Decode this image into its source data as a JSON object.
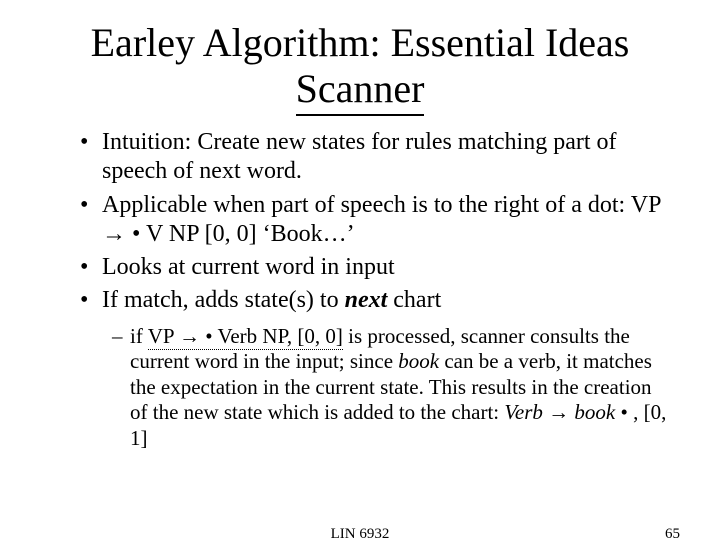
{
  "title_line1": "Earley Algorithm: Essential Ideas",
  "title_line2": "Scanner",
  "bullets": {
    "b1": "Intuition: Create new states for rules matching part of speech of next word.",
    "b2_pre": "Applicable when part of speech is to the right of a dot: VP ",
    "b2_arrow": "→",
    "b2_post": " • V NP [0, 0] ‘Book…’",
    "b3": "Looks at current word in input",
    "b4_pre": "If match, adds state(s) to ",
    "b4_strong": "next",
    "b4_post": " chart"
  },
  "sub": {
    "s_pre": "if ",
    "s_underline1": "VP ",
    "s_arrow": "→",
    "s_underline2": " • Verb NP, [0, 0]",
    "s_mid1": " is processed, scanner consults the current word in the input; since ",
    "s_it1": "book",
    "s_mid2": " can be a verb, it matches the expectation in the current state. This results in the creation of the new state which is added to the chart: ",
    "s_it2": "Verb ",
    "s_arrow2": "→",
    "s_it3": " book",
    "s_tail": " • , [0, 1]"
  },
  "footer": {
    "course": "LIN 6932",
    "num": "65"
  }
}
